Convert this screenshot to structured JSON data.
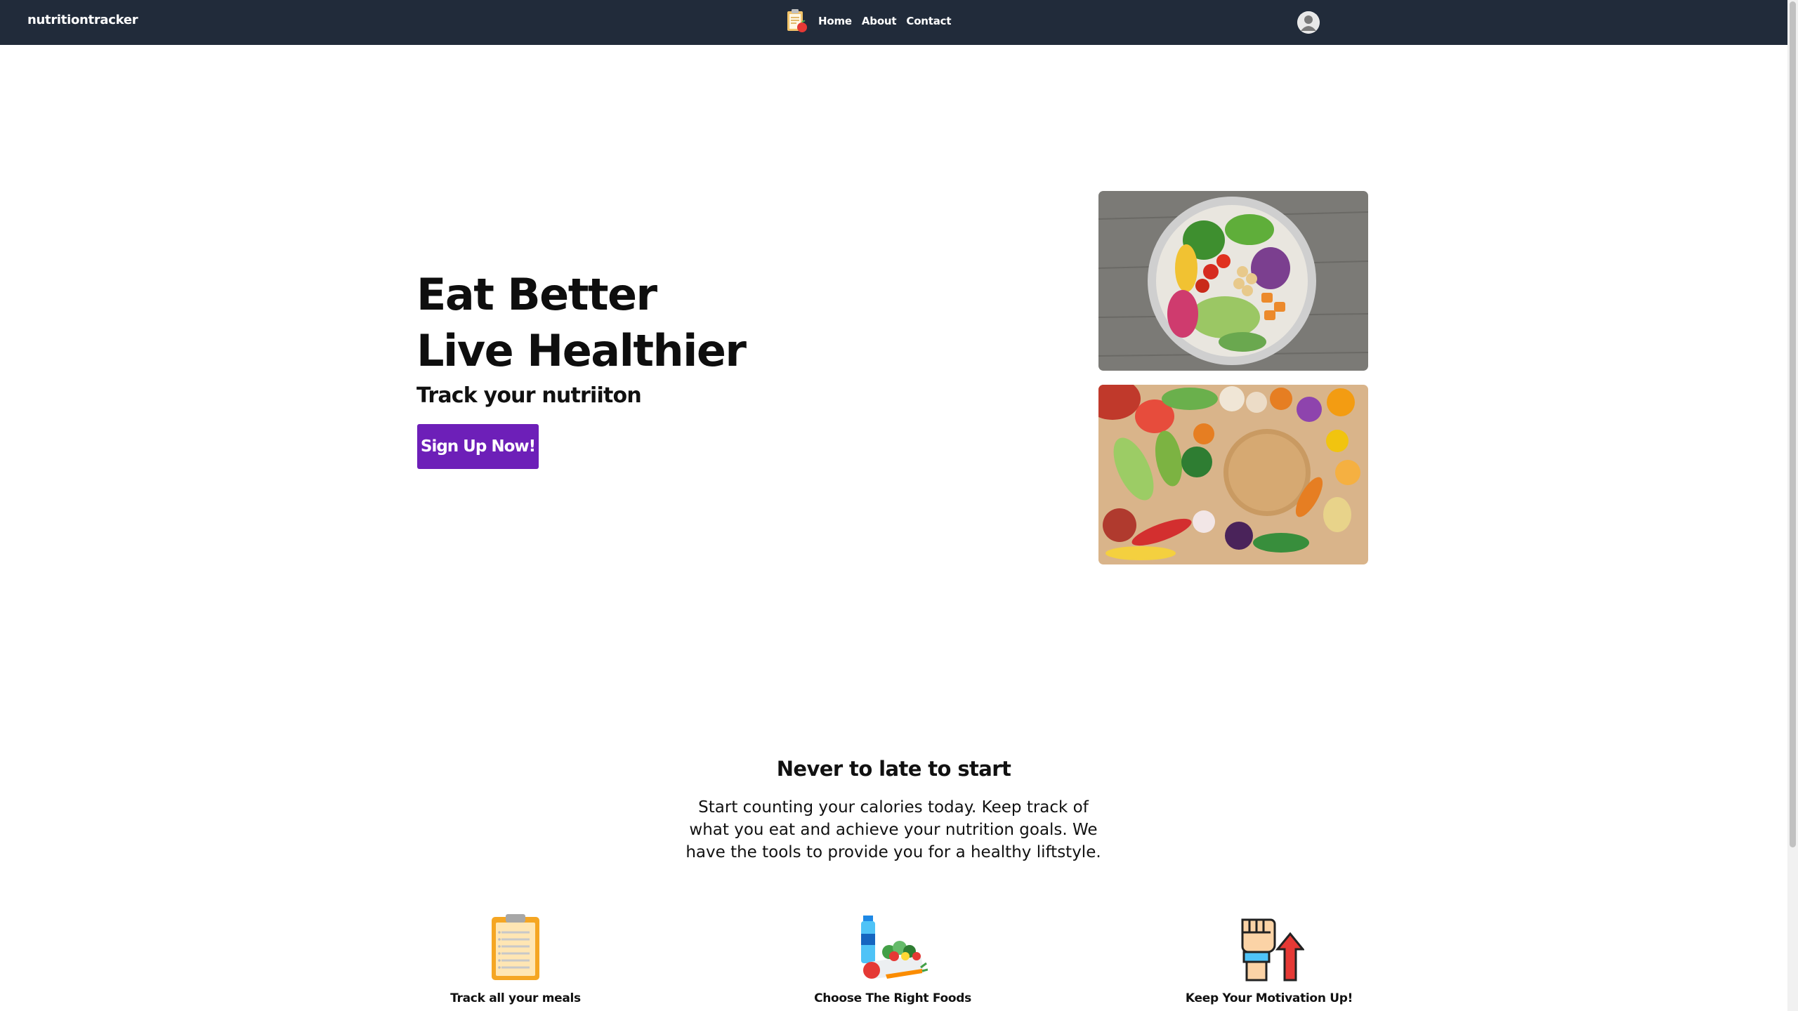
{
  "nav": {
    "brand": "nutritiontracker",
    "links": [
      "Home",
      "About",
      "Contact"
    ],
    "logo_icon": "clipboard-apple-icon",
    "avatar_icon": "user-avatar-icon"
  },
  "hero": {
    "line1": "Eat Better",
    "line2": "Live Healthier",
    "subtitle": "Track your nutriiton",
    "cta_label": "Sign Up Now!",
    "images": [
      "salad-bowl-photo",
      "vegetables-board-photo"
    ]
  },
  "intro": {
    "title": "Never to late to start",
    "text": "Start counting your calories today. Keep track of what you eat and achieve your nutrition goals. We have the tools to provide you for a healthy liftstyle."
  },
  "features": [
    {
      "label": "Track all your meals",
      "icon": "clipboard-icon"
    },
    {
      "label": "Choose The Right Foods",
      "icon": "healthy-food-icon"
    },
    {
      "label": "Keep Your Motivation Up!",
      "icon": "fist-arrow-up-icon"
    }
  ],
  "colors": {
    "navbar": "#212b3a",
    "accent": "#6d1fb8",
    "background": "#ffffff"
  }
}
